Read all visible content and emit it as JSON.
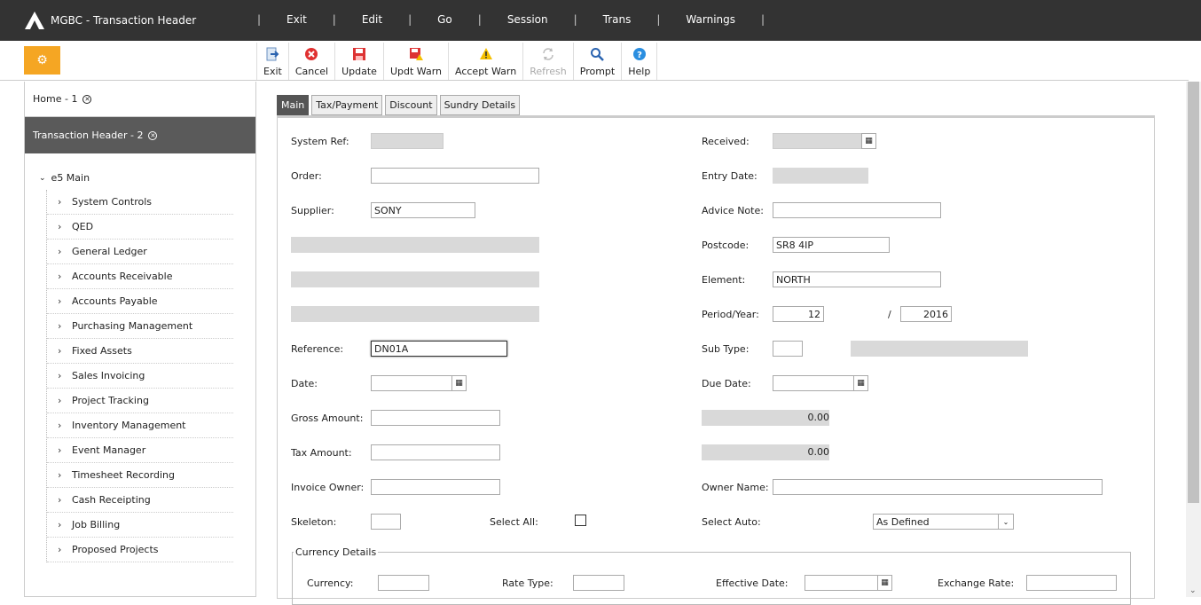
{
  "app": {
    "title": "MGBC - Transaction Header"
  },
  "menu": [
    "Exit",
    "Edit",
    "Go",
    "Session",
    "Trans",
    "Warnings"
  ],
  "toolbar": [
    {
      "label": "Exit",
      "icon": "exit-icon",
      "disabled": false
    },
    {
      "label": "Cancel",
      "icon": "cancel-icon",
      "disabled": false
    },
    {
      "label": "Update",
      "icon": "save-icon",
      "disabled": false
    },
    {
      "label": "Updt Warn",
      "icon": "save-warn-icon",
      "disabled": false
    },
    {
      "label": "Accept Warn",
      "icon": "warning-icon",
      "disabled": false
    },
    {
      "label": "Refresh",
      "icon": "refresh-icon",
      "disabled": true
    },
    {
      "label": "Prompt",
      "icon": "search-icon",
      "disabled": false
    },
    {
      "label": "Help",
      "icon": "help-icon",
      "disabled": false
    }
  ],
  "sidebar": {
    "home": "Home - 1",
    "active": "Transaction Header - 2",
    "root": "e5 Main",
    "items": [
      "System Controls",
      "QED",
      "General Ledger",
      "Accounts Receivable",
      "Accounts Payable",
      "Purchasing Management",
      "Fixed Assets",
      "Sales Invoicing",
      "Project Tracking",
      "Inventory Management",
      "Event Manager",
      "Timesheet Recording",
      "Cash Receipting",
      "Job Billing",
      "Proposed Projects"
    ]
  },
  "tabs": [
    "Main",
    "Tax/Payment",
    "Discount",
    "Sundry Details"
  ],
  "form": {
    "system_ref_label": "System Ref:",
    "order_label": "Order:",
    "supplier_label": "Supplier:",
    "supplier_value": "SONY",
    "reference_label": "Reference:",
    "reference_value": "DN01A",
    "date_label": "Date:",
    "gross_label": "Gross Amount:",
    "tax_label": "Tax Amount:",
    "invoice_owner_label": "Invoice Owner:",
    "skeleton_label": "Skeleton:",
    "select_all_label": "Select All:",
    "received_label": "Received:",
    "entry_date_label": "Entry Date:",
    "advice_note_label": "Advice Note:",
    "postcode_label": "Postcode:",
    "postcode_value": "SR8 4IP",
    "element_label": "Element:",
    "element_value": "NORTH",
    "period_year_label": "Period/Year:",
    "period_value": "12",
    "slash": "/",
    "year_value": "2016",
    "sub_type_label": "Sub Type:",
    "due_date_label": "Due Date:",
    "gross_total": "0.00",
    "tax_total": "0.00",
    "owner_name_label": "Owner Name:",
    "select_auto_label": "Select Auto:",
    "select_auto_value": "As Defined"
  },
  "currency": {
    "legend": "Currency Details",
    "currency_label": "Currency:",
    "rate_type_label": "Rate Type:",
    "effective_date_label": "Effective Date:",
    "exchange_rate_label": "Exchange Rate:"
  }
}
